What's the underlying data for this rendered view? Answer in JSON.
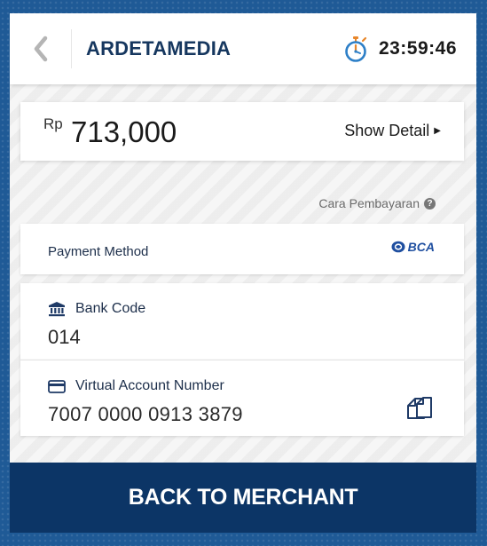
{
  "header": {
    "merchant_name": "ARDETAMEDIA",
    "timer": "23:59:46",
    "back_icon": "chevron-left-icon",
    "timer_icon": "stopwatch-icon"
  },
  "amount": {
    "currency": "Rp",
    "value": "713,000",
    "show_detail_label": "Show Detail"
  },
  "payment_guide": {
    "label": "Cara Pembayaran"
  },
  "payment_method": {
    "label": "Payment Method",
    "bank_logo_text": "BCA"
  },
  "bank_code": {
    "label": "Bank Code",
    "value": "014",
    "icon": "bank-icon"
  },
  "virtual_account": {
    "label": "Virtual Account Number",
    "value": "7007 0000 0913 3879",
    "icon": "credit-card-icon",
    "copy_icon": "copy-icon"
  },
  "footer": {
    "button_label": "BACK TO MERCHANT"
  },
  "colors": {
    "brand_dark": "#0c3566",
    "title_text": "#16375f",
    "background": "#1f5a96"
  }
}
